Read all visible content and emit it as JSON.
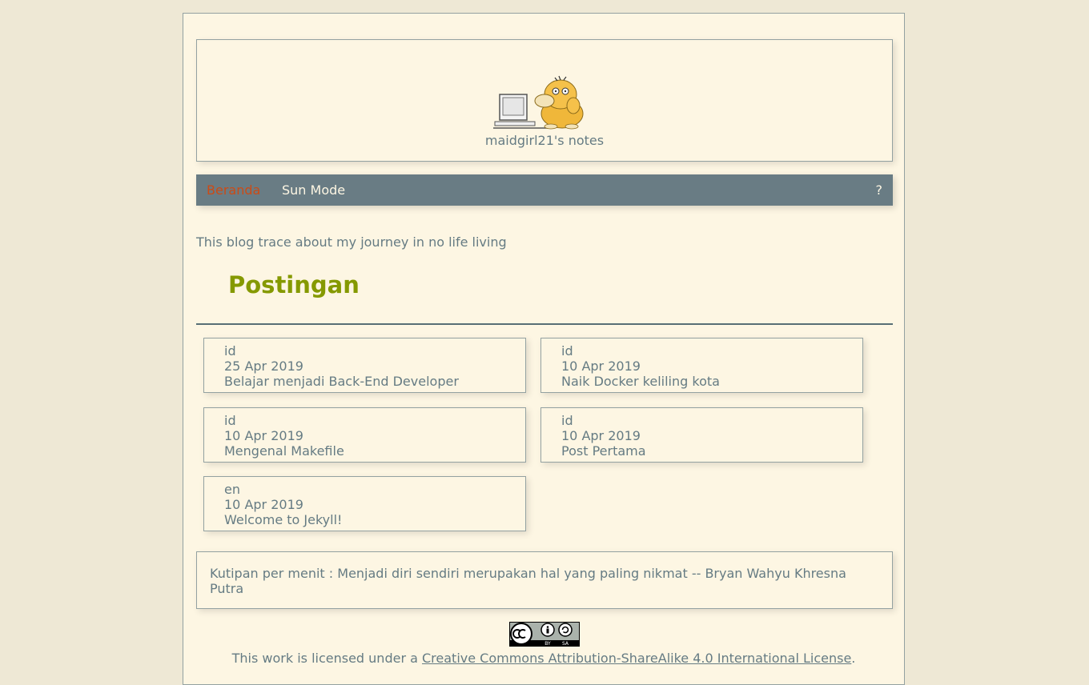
{
  "site": {
    "title": "maidgirl21's notes",
    "tagline": "This blog trace about my journey in no life living"
  },
  "nav": {
    "home": "Beranda",
    "sun_mode": "Sun Mode",
    "help": "?"
  },
  "posts": {
    "heading": "Postingan",
    "items": [
      {
        "lang": "id",
        "date": "25 Apr 2019",
        "title": "Belajar menjadi Back-End Developer"
      },
      {
        "lang": "id",
        "date": "10 Apr 2019",
        "title": "Naik Docker keliling kota"
      },
      {
        "lang": "id",
        "date": "10 Apr 2019",
        "title": "Mengenal Makefile"
      },
      {
        "lang": "id",
        "date": "10 Apr 2019",
        "title": "Post Pertama"
      },
      {
        "lang": "en",
        "date": "10 Apr 2019",
        "title": "Welcome to Jekyll!"
      }
    ]
  },
  "quote": {
    "text": "Kutipan per menit : Menjadi diri sendiri merupakan hal yang paling nikmat -- Bryan Wahyu Khresna Putra"
  },
  "footer": {
    "license_prefix": "This work is licensed under a ",
    "license_link": "Creative Commons Attribution-ShareAlike 4.0 International License",
    "license_suffix": ".",
    "badge_text": {
      "by": "BY",
      "sa": "SA"
    }
  },
  "colors": {
    "background": "#eee8d5",
    "page": "#fdf6e3",
    "text": "#657b83",
    "nav": "#697c84",
    "accent_orange": "#cb4b16",
    "heading_green": "#859900"
  }
}
